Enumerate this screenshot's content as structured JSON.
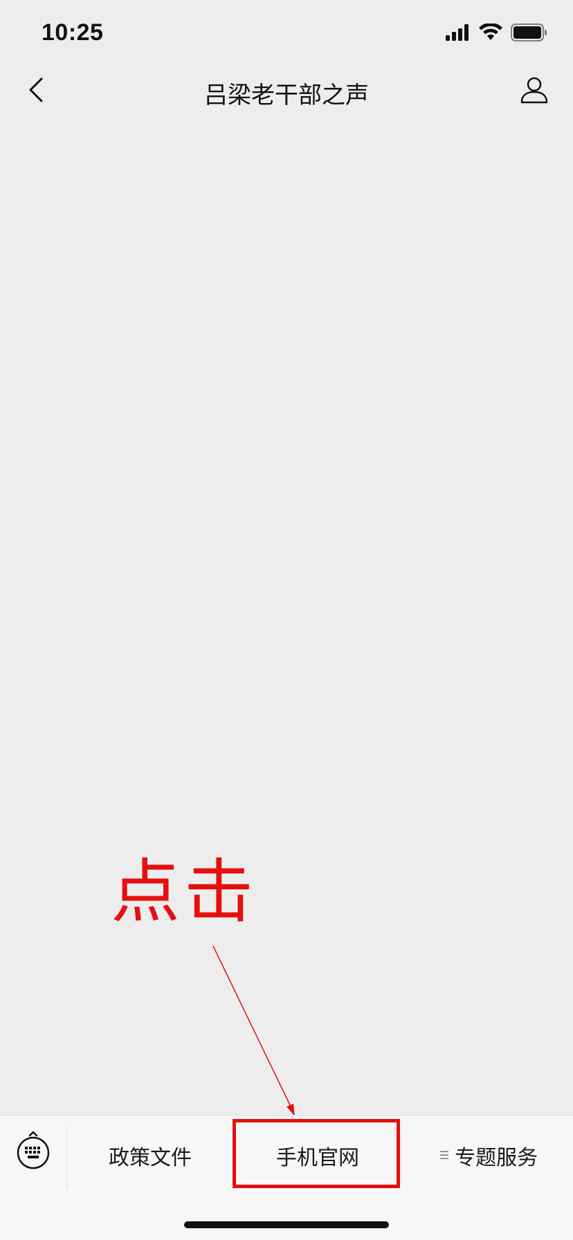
{
  "status_bar": {
    "time": "10:25",
    "icons": [
      "signal-icon",
      "wifi-icon",
      "battery-icon"
    ]
  },
  "nav": {
    "title": "吕梁老干部之声",
    "back_icon": "chevron-left-icon",
    "profile_icon": "person-icon"
  },
  "annotation": {
    "text": "点击",
    "color": "#e60f0f"
  },
  "bottom_menu": {
    "keyboard_icon": "keyboard-icon",
    "items": [
      {
        "label": "政策文件"
      },
      {
        "label": "手机官网"
      },
      {
        "label": "专题服务",
        "has_submenu_icon": true
      }
    ]
  }
}
